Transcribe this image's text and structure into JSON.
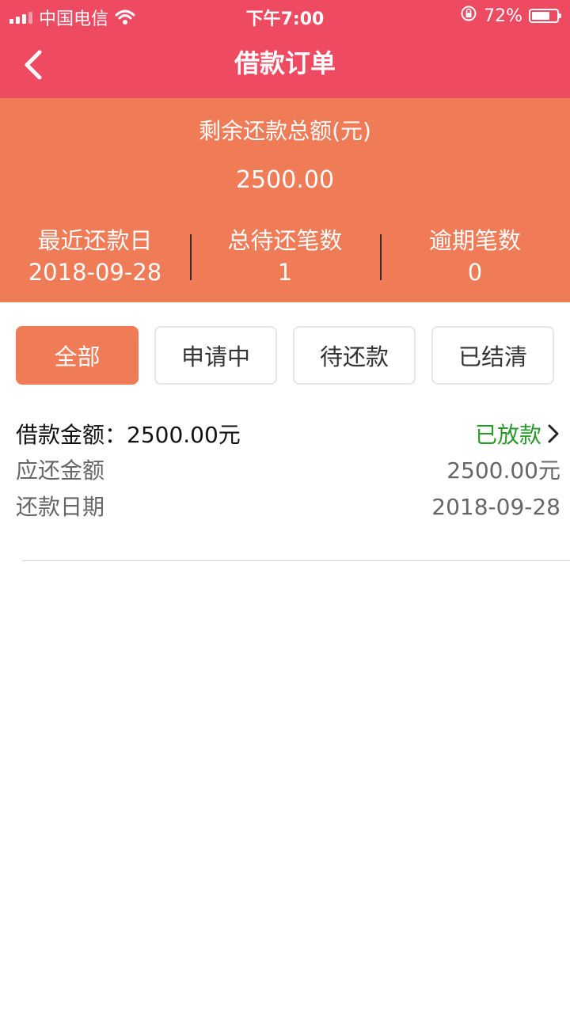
{
  "status_bar": {
    "carrier": "中国电信",
    "time": "下午7:00",
    "battery": "72%",
    "battery_level": 0.72
  },
  "header": {
    "title": "借款订单",
    "back_icon": "chevron-left-icon"
  },
  "summary": {
    "label": "剩余还款总额(元)",
    "value": "2500.00",
    "stats": [
      {
        "label": "最近还款日",
        "value": "2018-09-28"
      },
      {
        "label": "总待还笔数",
        "value": "1"
      },
      {
        "label": "逾期笔数",
        "value": "0"
      }
    ]
  },
  "tabs": [
    "全部",
    "申请中",
    "待还款",
    "已结清"
  ],
  "active_tab": 0,
  "order": {
    "amount_label": "借款金额：",
    "amount_value": "2500.00元",
    "status": "已放款",
    "rows": [
      {
        "label": "应还金额",
        "value": "2500.00元"
      },
      {
        "label": "还款日期",
        "value": "2018-09-28"
      }
    ]
  },
  "colors": {
    "header": "#ee4a62",
    "summary": "#ef7b57",
    "status_green": "#2a9a2a"
  }
}
